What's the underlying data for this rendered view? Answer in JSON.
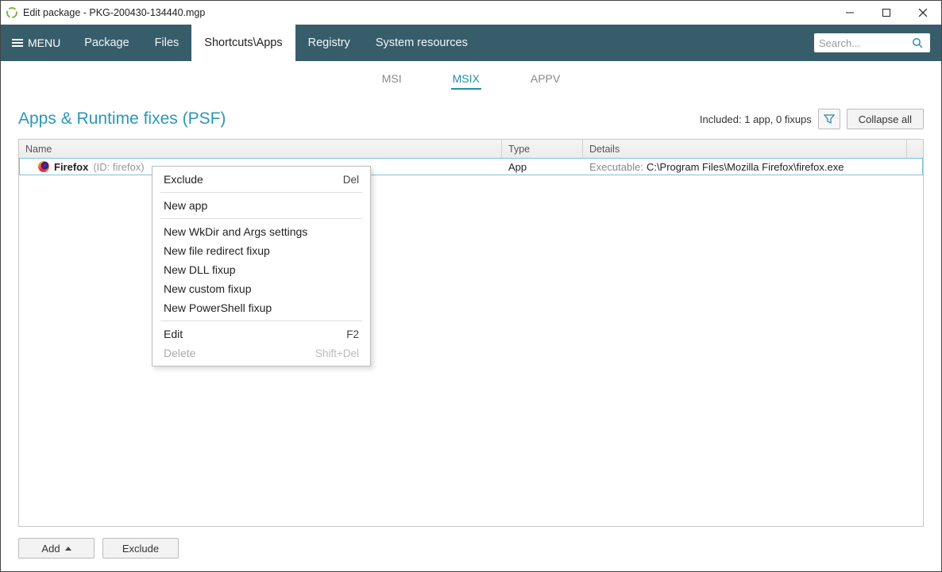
{
  "titlebar": {
    "title": "Edit package - PKG-200430-134440.mgp"
  },
  "menubar": {
    "menu_label": "MENU",
    "items": [
      "Package",
      "Files",
      "Shortcuts\\Apps",
      "Registry",
      "System resources"
    ],
    "active_index": 2,
    "search_placeholder": "Search..."
  },
  "subtabs": {
    "items": [
      "MSI",
      "MSIX",
      "APPV"
    ],
    "active_index": 1
  },
  "section": {
    "title": "Apps & Runtime fixes (PSF)",
    "included_text": "Included: 1 app, 0 fixups",
    "collapse_label": "Collapse all"
  },
  "grid": {
    "columns": [
      "Name",
      "Type",
      "Details"
    ],
    "rows": [
      {
        "icon": "firefox",
        "name": "Firefox",
        "id_label": "(ID: firefox)",
        "type": "App",
        "details_label": "Executable:",
        "details_value": "C:\\Program Files\\Mozilla Firefox\\firefox.exe"
      }
    ]
  },
  "context_menu": {
    "items": [
      {
        "label": "Exclude",
        "shortcut": "Del"
      },
      {
        "sep": true
      },
      {
        "label": "New app"
      },
      {
        "sep": true
      },
      {
        "label": "New WkDir and Args settings"
      },
      {
        "label": "New file redirect fixup"
      },
      {
        "label": "New DLL fixup"
      },
      {
        "label": "New custom fixup"
      },
      {
        "label": "New PowerShell fixup"
      },
      {
        "sep": true
      },
      {
        "label": "Edit",
        "shortcut": "F2"
      },
      {
        "label": "Delete",
        "shortcut": "Shift+Del",
        "disabled": true
      }
    ]
  },
  "footer": {
    "add_label": "Add",
    "exclude_label": "Exclude"
  }
}
